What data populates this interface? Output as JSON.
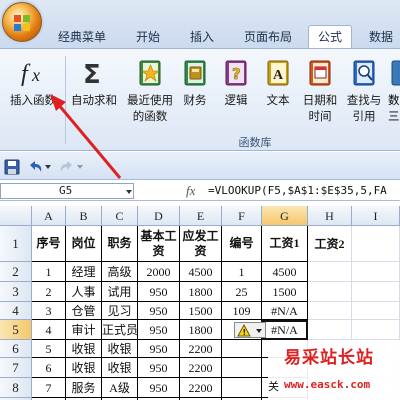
{
  "tabs": [
    {
      "label": "经典菜单"
    },
    {
      "label": "开始"
    },
    {
      "label": "插入"
    },
    {
      "label": "页面布局"
    },
    {
      "label": "公式",
      "active": true
    },
    {
      "label": "数据"
    }
  ],
  "ribbon": {
    "buttons": [
      {
        "line1": "插入函数",
        "line2": "",
        "icon": "fx-icon"
      },
      {
        "line1": "自动求和",
        "line2": "",
        "icon": "sigma-icon"
      },
      {
        "line1": "最近使用",
        "line2": "的函数",
        "icon": "star-book-icon"
      },
      {
        "line1": "财务",
        "line2": "",
        "icon": "finance-book-icon"
      },
      {
        "line1": "逻辑",
        "line2": "",
        "icon": "logic-book-icon"
      },
      {
        "line1": "文本",
        "line2": "",
        "icon": "text-book-icon"
      },
      {
        "line1": "日期和",
        "line2": "时间",
        "icon": "datetime-book-icon"
      },
      {
        "line1": "查找与",
        "line2": "引用",
        "icon": "lookup-book-icon"
      },
      {
        "line1": "数",
        "line2": "三",
        "icon": "math-book-icon"
      }
    ],
    "group_label": "函数库"
  },
  "qat": {
    "icons": [
      "save-icon",
      "undo-icon",
      "redo-icon"
    ]
  },
  "formula_bar": {
    "name_box": "G5",
    "fx_label": "fx",
    "formula": "=VLOOKUP(F5,$A$1:$E$35,5,FA"
  },
  "columns": [
    "A",
    "B",
    "C",
    "D",
    "E",
    "F",
    "G",
    "H",
    "I"
  ],
  "rows": [
    "1",
    "2",
    "3",
    "4",
    "5",
    "6",
    "7",
    "8",
    "9"
  ],
  "table": {
    "header": [
      "序号",
      "岗位",
      "职务",
      "基本工资",
      "应发工资",
      "编号",
      "工资1",
      "工资2"
    ],
    "data": [
      [
        "1",
        "经理",
        "高级",
        "2000",
        "4500",
        "1",
        "4500",
        ""
      ],
      [
        "2",
        "人事",
        "试用",
        "950",
        "1800",
        "25",
        "1500",
        ""
      ],
      [
        "3",
        "仓管",
        "见习",
        "950",
        "1500",
        "109",
        "#N/A",
        ""
      ],
      [
        "4",
        "审计",
        "正式员",
        "950",
        "1800",
        "",
        "#N/A",
        ""
      ],
      [
        "5",
        "收银",
        "收银",
        "950",
        "2200",
        "",
        "",
        ""
      ],
      [
        "6",
        "收银",
        "收银",
        "950",
        "2200",
        "",
        "",
        ""
      ],
      [
        "7",
        "服务",
        "A级",
        "950",
        "2200",
        "",
        "",
        ""
      ],
      [
        "",
        "服务",
        "A级",
        "",
        "",
        "",
        "",
        ""
      ]
    ]
  },
  "error_indicator": {
    "icon": "warning-icon",
    "dropdown": "chevron-down-icon"
  },
  "watermark": {
    "title": "易采站长站",
    "url": "www.easck.com",
    "prefix": "关"
  },
  "colors": {
    "accent_tab": "#ffffff",
    "ribbon": "#dce7f5",
    "arrow": "#e02020",
    "watermark": "#d22222"
  }
}
